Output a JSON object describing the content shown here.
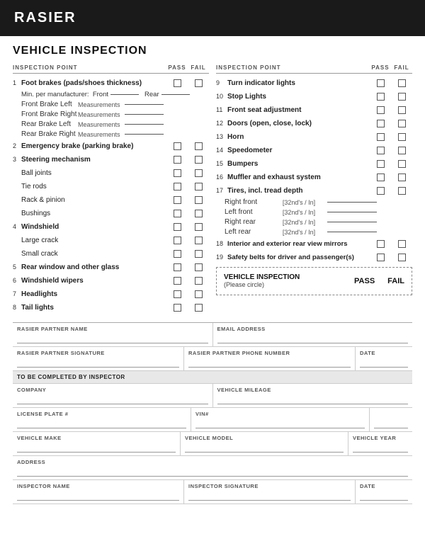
{
  "header": {
    "title": "RASIER"
  },
  "page_title": "VEHICLE INSPECTION",
  "left_column": {
    "header": {
      "label": "INSPECTION POINT",
      "pass": "PASS",
      "fail": "FAIL"
    },
    "items": [
      {
        "number": "1",
        "label": "Foot brakes (pads/shoes thickness)",
        "bold": true,
        "has_checkbox": true,
        "sub_items": [
          {
            "type": "min_per",
            "text": "Min. per manufacturer:  Front"
          },
          {
            "type": "measurement",
            "label": "Front Brake Left",
            "measure": "Measurements"
          },
          {
            "type": "measurement",
            "label": "Front Brake Right",
            "measure": "Measurements"
          },
          {
            "type": "measurement",
            "label": "Rear Brake Left",
            "measure": "Measurements"
          },
          {
            "type": "measurement",
            "label": "Rear Brake Right",
            "measure": "Measurements"
          }
        ]
      },
      {
        "number": "2",
        "label": "Emergency brake (parking brake)",
        "bold": true,
        "has_checkbox": true
      },
      {
        "number": "3",
        "label": "Steering mechanism",
        "bold": true,
        "has_checkbox": true,
        "sub_items": [
          {
            "type": "checkbox_item",
            "label": "Ball joints"
          },
          {
            "type": "checkbox_item",
            "label": "Tie rods"
          },
          {
            "type": "checkbox_item",
            "label": "Rack & pinion"
          },
          {
            "type": "checkbox_item",
            "label": "Bushings"
          }
        ]
      },
      {
        "number": "4",
        "label": "Windshield",
        "bold": true,
        "has_checkbox": true,
        "sub_items": [
          {
            "type": "checkbox_item",
            "label": "Large crack"
          },
          {
            "type": "checkbox_item",
            "label": "Small crack"
          }
        ]
      },
      {
        "number": "5",
        "label": "Rear window and other glass",
        "bold": true,
        "has_checkbox": true
      },
      {
        "number": "6",
        "label": "Windshield wipers",
        "bold": true,
        "has_checkbox": true
      },
      {
        "number": "7",
        "label": "Headlights",
        "bold": true,
        "has_checkbox": true
      },
      {
        "number": "8",
        "label": "Tail lights",
        "bold": true,
        "has_checkbox": true
      }
    ]
  },
  "right_column": {
    "header": {
      "label": "INSPECTION POINT",
      "pass": "PASS",
      "fail": "FAIL"
    },
    "items": [
      {
        "number": "9",
        "label": "Turn indicator lights",
        "bold": true
      },
      {
        "number": "10",
        "label": "Stop Lights",
        "bold": true
      },
      {
        "number": "11",
        "label": "Front seat adjustment",
        "bold": true
      },
      {
        "number": "12",
        "label": "Doors (open, close, lock)",
        "bold": true
      },
      {
        "number": "13",
        "label": "Horn",
        "bold": true
      },
      {
        "number": "14",
        "label": "Speedometer",
        "bold": true
      },
      {
        "number": "15",
        "label": "Bumpers",
        "bold": true
      },
      {
        "number": "16",
        "label": "Muffler and exhaust system",
        "bold": true
      },
      {
        "number": "17",
        "label": "Tires, incl. tread depth",
        "bold": true,
        "tread_items": [
          {
            "label": "Right front",
            "measure": "[32nd's / In]"
          },
          {
            "label": "Left front",
            "measure": "[32nd's / In]"
          },
          {
            "label": "Right rear",
            "measure": "[32nd's / In]"
          },
          {
            "label": "Left rear",
            "measure": "[32nd's / In]"
          }
        ]
      },
      {
        "number": "18",
        "label": "Interior and exterior rear view mirrors",
        "bold": true
      },
      {
        "number": "19",
        "label": "Safety belts for driver and passenger(s)",
        "bold": true
      }
    ],
    "vehicle_inspection_box": {
      "label": "VEHICLE INSPECTION",
      "sub": "(Please circle)",
      "pass": "PASS",
      "fail": "FAIL"
    }
  },
  "form_sections": {
    "partner_row": {
      "fields": [
        {
          "label": "RASIER PARTNER NAME"
        },
        {
          "label": "EMAIL ADDRESS"
        }
      ]
    },
    "signature_row": {
      "fields": [
        {
          "label": "RASIER PARTNER SIGNATURE"
        },
        {
          "label": "RASIER PARTNER PHONE NUMBER"
        },
        {
          "label": "DATE"
        }
      ]
    },
    "inspector_section_label": "TO BE COMPLETED BY INSPECTOR",
    "inspector_rows": [
      {
        "fields": [
          {
            "label": "COMPANY"
          },
          {
            "label": "VEHICLE MILEAGE"
          }
        ]
      },
      {
        "fields": [
          {
            "label": "LICENSE PLATE #"
          },
          {
            "label": "VIN#"
          },
          {
            "label": ""
          }
        ]
      },
      {
        "fields": [
          {
            "label": "VEHICLE MAKE"
          },
          {
            "label": "VEHICLE MODEL"
          },
          {
            "label": "VEHICLE YEAR"
          }
        ]
      },
      {
        "fields": [
          {
            "label": "ADDRESS"
          }
        ]
      },
      {
        "fields": [
          {
            "label": "INSPECTOR NAME"
          },
          {
            "label": "INSPECTOR SIGNATURE"
          },
          {
            "label": "DATE"
          }
        ]
      }
    ]
  }
}
